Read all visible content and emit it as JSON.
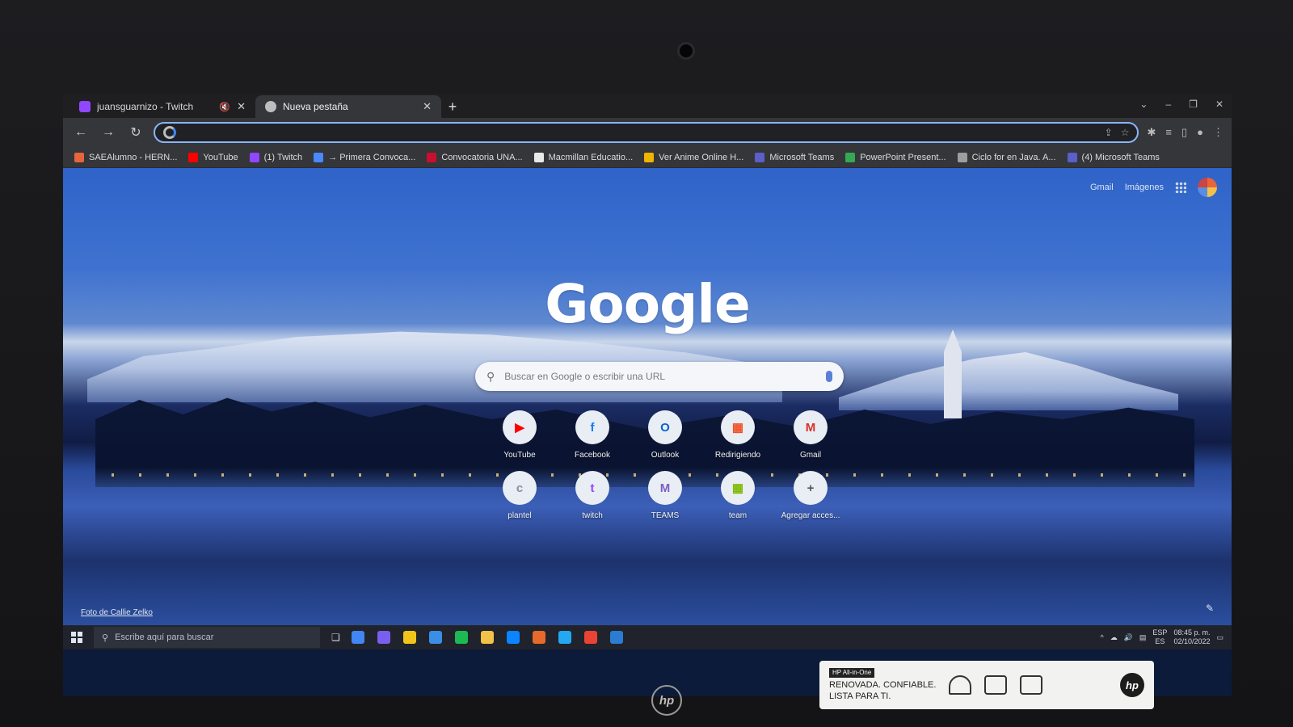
{
  "browser": {
    "tabs": [
      {
        "label": "juansguarnizo - Twitch",
        "active": false,
        "fav_color": "#9146ff",
        "muted_icon": "speaker-muted-icon"
      },
      {
        "label": "Nueva pestaña",
        "active": true,
        "fav_color": "#bdbdbd"
      }
    ],
    "new_tab_symbol": "+",
    "omnibox_value": "",
    "bookmarks": [
      {
        "label": "SAEAlumno - HERN...",
        "color": "#e8643c"
      },
      {
        "label": "YouTube",
        "color": "#ff0000"
      },
      {
        "label": "(1) Twitch",
        "color": "#9146ff"
      },
      {
        "label": "→ Primera Convoca...",
        "color": "#4a88ff"
      },
      {
        "label": "Convocatoria UNA...",
        "color": "#c8102e"
      },
      {
        "label": "Macmillan Educatio...",
        "color": "#e8e8e8"
      },
      {
        "label": "Ver Anime Online H...",
        "color": "#f0b400"
      },
      {
        "label": "Microsoft Teams",
        "color": "#5b5fc7"
      },
      {
        "label": "PowerPoint Present...",
        "color": "#34a853"
      },
      {
        "label": "Ciclo for en Java. A...",
        "color": "#9e9e9e"
      },
      {
        "label": "(4) Microsoft Teams",
        "color": "#5b5fc7"
      }
    ]
  },
  "newtab": {
    "top_links": {
      "gmail": "Gmail",
      "images": "Imágenes"
    },
    "logo": "Google",
    "search_placeholder": "Buscar en Google o escribir una URL",
    "shortcuts": [
      {
        "name": "YouTube",
        "glyph": "▶",
        "color": "#ff0000"
      },
      {
        "name": "Facebook",
        "glyph": "f",
        "color": "#1877f2"
      },
      {
        "name": "Outlook",
        "glyph": "O",
        "color": "#0a64c8"
      },
      {
        "name": "Redirigiendo",
        "glyph": "▦",
        "color": "#f25022"
      },
      {
        "name": "Gmail",
        "glyph": "M",
        "color": "#d93025"
      },
      {
        "name": "plantel",
        "glyph": "c",
        "color": "#8a8f99"
      },
      {
        "name": "twitch",
        "glyph": "t",
        "color": "#9146ff"
      },
      {
        "name": "TEAMS",
        "glyph": "M",
        "color": "#7b5fc7"
      },
      {
        "name": "team",
        "glyph": "▦",
        "color": "#7fba00"
      },
      {
        "name": "Agregar acces...",
        "glyph": "+",
        "color": "#555555"
      }
    ],
    "photo_credit": "Foto de Callie Zelko"
  },
  "taskbar": {
    "search_placeholder": "Escribe aquí para buscar",
    "apps": [
      "#4285f4",
      "#7a5ef0",
      "#f0c419",
      "#3a8ee6",
      "#1db954",
      "#f2c14a",
      "#0a84ff",
      "#e66a2c",
      "#23a9f2",
      "#ea4335",
      "#2b7cd3"
    ],
    "lang": "ESP",
    "lang_sub": "ES",
    "time": "08:45 p. m.",
    "date": "02/10/2022"
  },
  "sticker": {
    "brand": "HP All-in-One",
    "line1": "RENOVADA. CONFIABLE.",
    "line2": "LISTA PARA TI.",
    "badge": "hp"
  },
  "monitor_logo": "hp"
}
